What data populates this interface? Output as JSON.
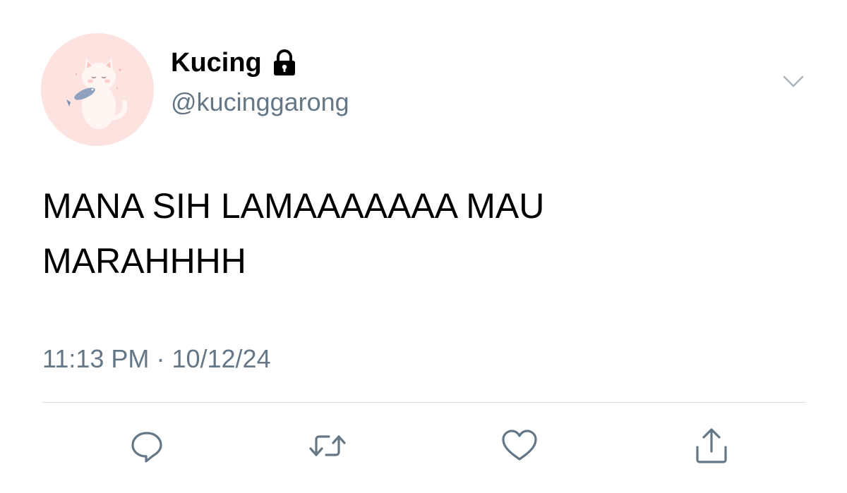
{
  "tweet": {
    "display_name": "Kucing",
    "handle": "@kucinggarong",
    "text_line_1": "MANA SIH LAMAAAAAAA MAU",
    "text_line_2": "MARAHHHH",
    "time": "11:13 PM",
    "separator": "·",
    "date": "10/12/24",
    "protected_icon": "lock-icon",
    "menu_icon": "chevron-down-icon"
  },
  "actions": {
    "reply_icon": "reply-icon",
    "retweet_icon": "retweet-icon",
    "like_icon": "heart-icon",
    "share_icon": "share-icon"
  },
  "colors": {
    "text": "#000000",
    "secondary_text": "#657786",
    "icon": "#657786",
    "divider": "#d9dde1",
    "avatar_background": "#fde3e0"
  }
}
